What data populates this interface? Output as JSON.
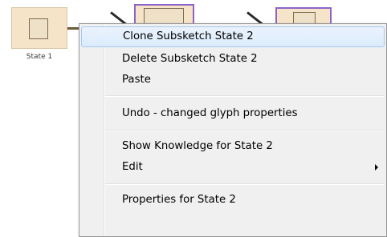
{
  "canvas": {
    "state1_label": "State 1"
  },
  "context_menu": {
    "items": [
      {
        "label": "Clone Subsketch State 2"
      },
      {
        "label": "Delete Subsketch State 2"
      },
      {
        "label": "Paste"
      },
      {
        "label": "Undo - changed glyph properties"
      },
      {
        "label": "Show Knowledge for State 2"
      },
      {
        "label": "Edit"
      },
      {
        "label": "Properties for State 2"
      }
    ]
  },
  "icons": {
    "submenu": "chevron-right-icon"
  }
}
